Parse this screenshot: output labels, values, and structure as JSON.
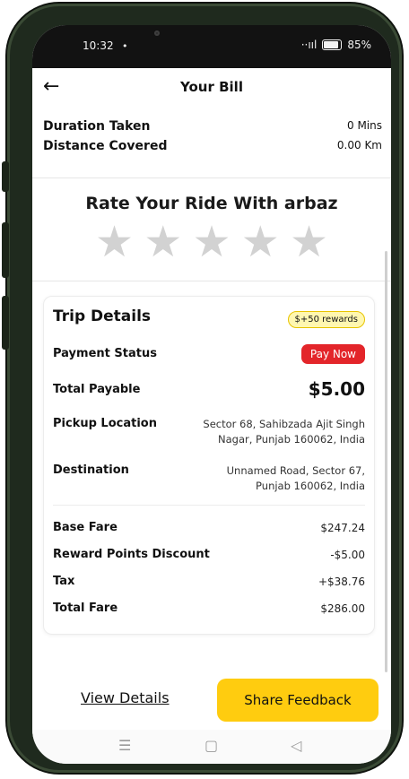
{
  "status_bar": {
    "time": "10:32",
    "notification_dot": "•",
    "signal": "··ııl",
    "battery_percent": "85%"
  },
  "header": {
    "back_icon": "arrow-left-icon",
    "title": "Your Bill"
  },
  "trip_summary": {
    "duration_label": "Duration Taken",
    "duration_value": "0 Mins",
    "distance_label": "Distance Covered",
    "distance_value": "0.00 Km"
  },
  "rating": {
    "title": "Rate Your Ride With arbaz",
    "stars_total": 5,
    "stars_selected": 0
  },
  "trip_details": {
    "title": "Trip Details",
    "reward_badge": "$+50 rewards",
    "payment_status_label": "Payment Status",
    "pay_now_label": "Pay Now",
    "total_payable_label": "Total Payable",
    "total_payable_value": "$5.00",
    "pickup_label": "Pickup Location",
    "pickup_line1": "Sector 68, Sahibzada Ajit Singh",
    "pickup_line2": "Nagar, Punjab 160062, India",
    "destination_label": "Destination",
    "destination_line1": "Unnamed Road, Sector 67,",
    "destination_line2": "Punjab 160062, India",
    "fares": [
      {
        "label": "Base Fare",
        "value": "$247.24"
      },
      {
        "label": "Reward Points Discount",
        "value": "-$5.00"
      },
      {
        "label": "Tax",
        "value": "+$38.76"
      },
      {
        "label": "Total Fare",
        "value": "$286.00"
      }
    ]
  },
  "actions": {
    "view_details": "View Details",
    "share_feedback": "Share Feedback"
  },
  "colors": {
    "accent_yellow": "#ffcc0f",
    "pay_now_red": "#e3252a",
    "star_gray": "#d2d2d2"
  }
}
